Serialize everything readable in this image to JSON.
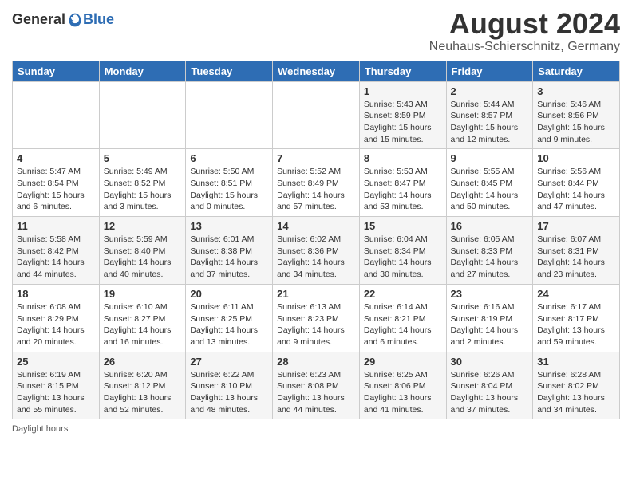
{
  "header": {
    "logo_general": "General",
    "logo_blue": "Blue",
    "title": "August 2024",
    "subtitle": "Neuhaus-Schierschnitz, Germany"
  },
  "calendar": {
    "days_of_week": [
      "Sunday",
      "Monday",
      "Tuesday",
      "Wednesday",
      "Thursday",
      "Friday",
      "Saturday"
    ],
    "weeks": [
      [
        {
          "day": "",
          "info": ""
        },
        {
          "day": "",
          "info": ""
        },
        {
          "day": "",
          "info": ""
        },
        {
          "day": "",
          "info": ""
        },
        {
          "day": "1",
          "info": "Sunrise: 5:43 AM\nSunset: 8:59 PM\nDaylight: 15 hours and 15 minutes."
        },
        {
          "day": "2",
          "info": "Sunrise: 5:44 AM\nSunset: 8:57 PM\nDaylight: 15 hours and 12 minutes."
        },
        {
          "day": "3",
          "info": "Sunrise: 5:46 AM\nSunset: 8:56 PM\nDaylight: 15 hours and 9 minutes."
        }
      ],
      [
        {
          "day": "4",
          "info": "Sunrise: 5:47 AM\nSunset: 8:54 PM\nDaylight: 15 hours and 6 minutes."
        },
        {
          "day": "5",
          "info": "Sunrise: 5:49 AM\nSunset: 8:52 PM\nDaylight: 15 hours and 3 minutes."
        },
        {
          "day": "6",
          "info": "Sunrise: 5:50 AM\nSunset: 8:51 PM\nDaylight: 15 hours and 0 minutes."
        },
        {
          "day": "7",
          "info": "Sunrise: 5:52 AM\nSunset: 8:49 PM\nDaylight: 14 hours and 57 minutes."
        },
        {
          "day": "8",
          "info": "Sunrise: 5:53 AM\nSunset: 8:47 PM\nDaylight: 14 hours and 53 minutes."
        },
        {
          "day": "9",
          "info": "Sunrise: 5:55 AM\nSunset: 8:45 PM\nDaylight: 14 hours and 50 minutes."
        },
        {
          "day": "10",
          "info": "Sunrise: 5:56 AM\nSunset: 8:44 PM\nDaylight: 14 hours and 47 minutes."
        }
      ],
      [
        {
          "day": "11",
          "info": "Sunrise: 5:58 AM\nSunset: 8:42 PM\nDaylight: 14 hours and 44 minutes."
        },
        {
          "day": "12",
          "info": "Sunrise: 5:59 AM\nSunset: 8:40 PM\nDaylight: 14 hours and 40 minutes."
        },
        {
          "day": "13",
          "info": "Sunrise: 6:01 AM\nSunset: 8:38 PM\nDaylight: 14 hours and 37 minutes."
        },
        {
          "day": "14",
          "info": "Sunrise: 6:02 AM\nSunset: 8:36 PM\nDaylight: 14 hours and 34 minutes."
        },
        {
          "day": "15",
          "info": "Sunrise: 6:04 AM\nSunset: 8:34 PM\nDaylight: 14 hours and 30 minutes."
        },
        {
          "day": "16",
          "info": "Sunrise: 6:05 AM\nSunset: 8:33 PM\nDaylight: 14 hours and 27 minutes."
        },
        {
          "day": "17",
          "info": "Sunrise: 6:07 AM\nSunset: 8:31 PM\nDaylight: 14 hours and 23 minutes."
        }
      ],
      [
        {
          "day": "18",
          "info": "Sunrise: 6:08 AM\nSunset: 8:29 PM\nDaylight: 14 hours and 20 minutes."
        },
        {
          "day": "19",
          "info": "Sunrise: 6:10 AM\nSunset: 8:27 PM\nDaylight: 14 hours and 16 minutes."
        },
        {
          "day": "20",
          "info": "Sunrise: 6:11 AM\nSunset: 8:25 PM\nDaylight: 14 hours and 13 minutes."
        },
        {
          "day": "21",
          "info": "Sunrise: 6:13 AM\nSunset: 8:23 PM\nDaylight: 14 hours and 9 minutes."
        },
        {
          "day": "22",
          "info": "Sunrise: 6:14 AM\nSunset: 8:21 PM\nDaylight: 14 hours and 6 minutes."
        },
        {
          "day": "23",
          "info": "Sunrise: 6:16 AM\nSunset: 8:19 PM\nDaylight: 14 hours and 2 minutes."
        },
        {
          "day": "24",
          "info": "Sunrise: 6:17 AM\nSunset: 8:17 PM\nDaylight: 13 hours and 59 minutes."
        }
      ],
      [
        {
          "day": "25",
          "info": "Sunrise: 6:19 AM\nSunset: 8:15 PM\nDaylight: 13 hours and 55 minutes."
        },
        {
          "day": "26",
          "info": "Sunrise: 6:20 AM\nSunset: 8:12 PM\nDaylight: 13 hours and 52 minutes."
        },
        {
          "day": "27",
          "info": "Sunrise: 6:22 AM\nSunset: 8:10 PM\nDaylight: 13 hours and 48 minutes."
        },
        {
          "day": "28",
          "info": "Sunrise: 6:23 AM\nSunset: 8:08 PM\nDaylight: 13 hours and 44 minutes."
        },
        {
          "day": "29",
          "info": "Sunrise: 6:25 AM\nSunset: 8:06 PM\nDaylight: 13 hours and 41 minutes."
        },
        {
          "day": "30",
          "info": "Sunrise: 6:26 AM\nSunset: 8:04 PM\nDaylight: 13 hours and 37 minutes."
        },
        {
          "day": "31",
          "info": "Sunrise: 6:28 AM\nSunset: 8:02 PM\nDaylight: 13 hours and 34 minutes."
        }
      ]
    ]
  },
  "footer": {
    "note": "Daylight hours"
  }
}
